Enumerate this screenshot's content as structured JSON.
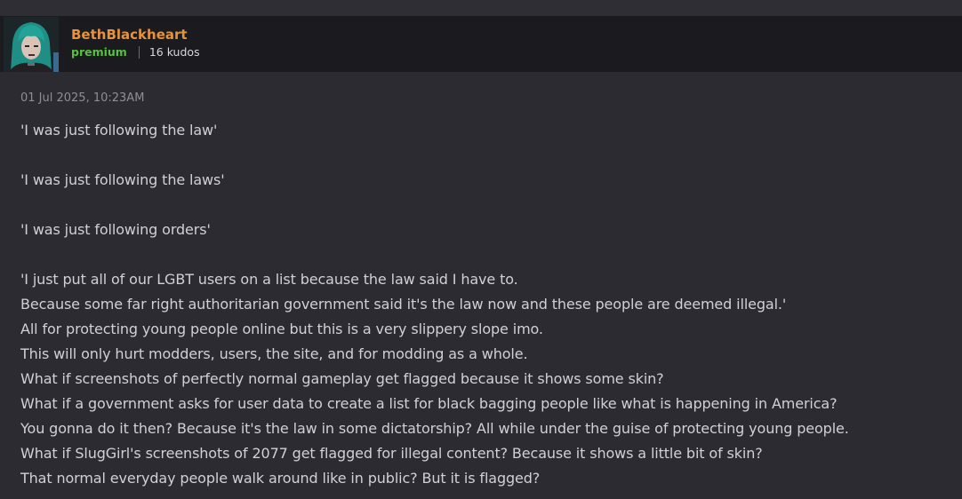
{
  "author": {
    "name": "BethBlackheart",
    "badge": "premium",
    "kudos": "16 kudos"
  },
  "post": {
    "timestamp": "01 Jul 2025, 10:23AM",
    "lines": [
      "'I was just following the law'",
      "",
      "'I was just following the laws'",
      "",
      "'I was just following orders'",
      "",
      "'I just put all of our LGBT users on a list because the law said I have to.",
      "Because some far right authoritarian government said it's the law now and these people are deemed illegal.'",
      "All for protecting young people online but this is a very slippery slope imo.",
      "This will only hurt modders, users, the site, and for modding as a whole.",
      "What if screenshots of perfectly normal gameplay get flagged because it shows some skin?",
      "What if a government asks for user data to create a list for black bagging people like what is happening in America?",
      "You gonna do it then? Because it's the law in some dictatorship? All while under the guise of protecting young people.",
      "What if SlugGirl's screenshots of 2077 get flagged for illegal content? Because it shows a little bit of skin?",
      "That normal everyday people walk around like in public? But it is flagged?"
    ]
  },
  "colors": {
    "author_name": "#e8923a",
    "premium": "#56c13c",
    "page_background": "#2b2b31",
    "author_bar_background": "#1b1b1f",
    "body_text": "#d0d0d5",
    "timestamp_text": "#8e8e95"
  }
}
